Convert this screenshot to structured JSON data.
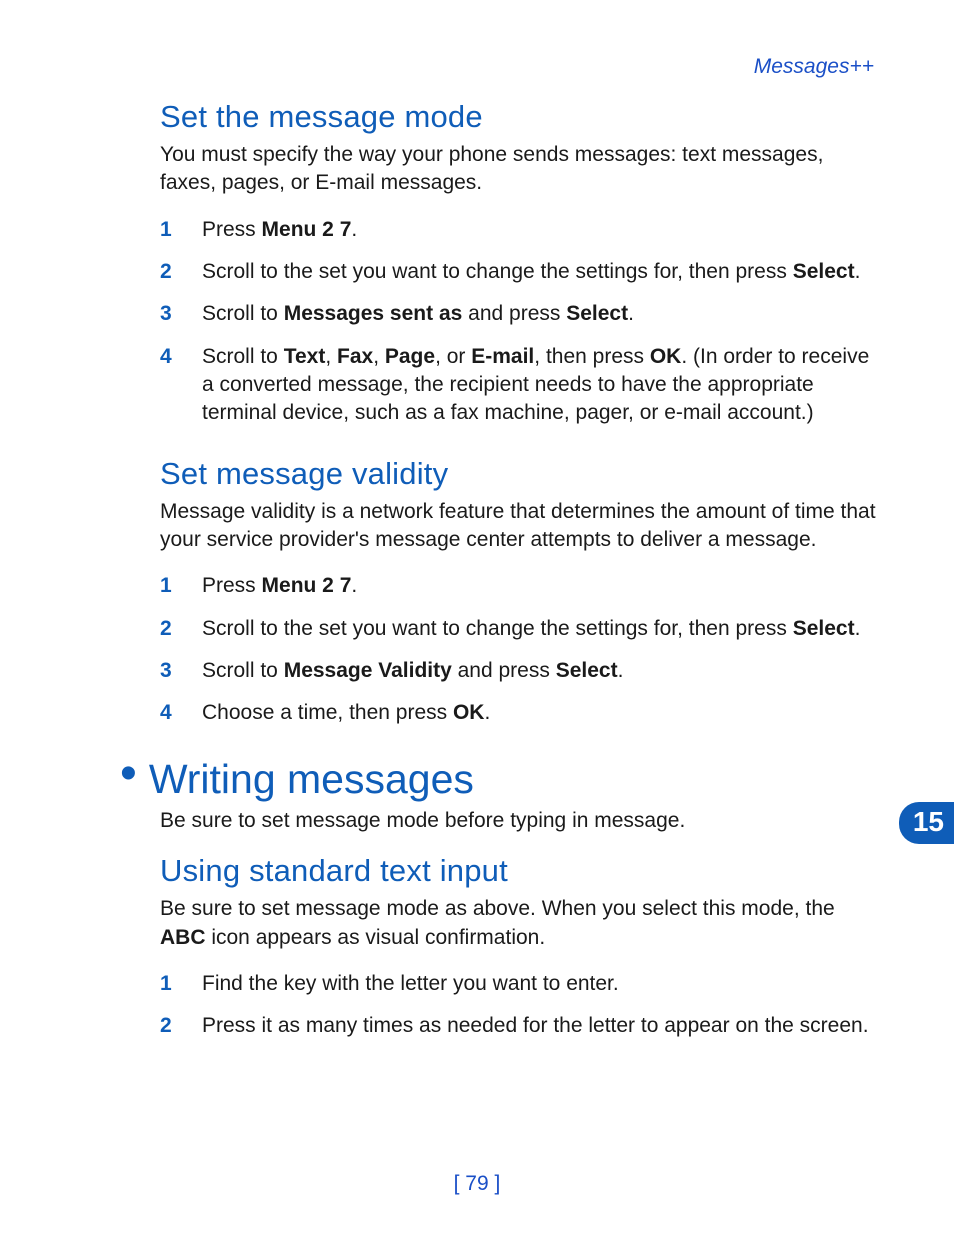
{
  "header": {
    "running": "Messages++"
  },
  "sections": {
    "mode": {
      "title": "Set the message mode",
      "intro": "You must specify the way your phone sends messages: text messages, faxes, pages, or E-mail messages.",
      "steps": [
        {
          "n": "1",
          "pre": "Press ",
          "b1": "Menu 2 7",
          "post": "."
        },
        {
          "n": "2",
          "pre": "Scroll to the set you want to change the settings for, then press ",
          "b1": "Select",
          "post": "."
        },
        {
          "n": "3",
          "pre": "Scroll to ",
          "b1": "Messages sent as",
          "mid": " and press ",
          "b2": "Select",
          "post": "."
        },
        {
          "n": "4",
          "pre": "Scroll to ",
          "b1": "Text",
          "c1": ", ",
          "b2": "Fax",
          "c2": ", ",
          "b3": "Page",
          "c3": ", or ",
          "b4": "E-mail",
          "mid": ", then press ",
          "b5": "OK",
          "post": ". (In order to receive a converted message, the recipient needs to have the appropriate terminal device, such as a fax machine, pager, or e-mail account.)"
        }
      ]
    },
    "validity": {
      "title": "Set message validity",
      "intro": "Message validity is a network feature that determines the amount of time that your service provider's message center attempts to deliver a message.",
      "steps": [
        {
          "n": "1",
          "pre": "Press ",
          "b1": "Menu 2 7",
          "post": "."
        },
        {
          "n": "2",
          "pre": "Scroll to the set you want to change the settings for, then press ",
          "b1": "Select",
          "post": "."
        },
        {
          "n": "3",
          "pre": "Scroll to ",
          "b1": "Message Validity",
          "mid": " and press ",
          "b2": "Select",
          "post": "."
        },
        {
          "n": "4",
          "pre": "Choose a time, then press ",
          "b1": "OK",
          "post": "."
        }
      ]
    },
    "writing": {
      "title": "Writing messages",
      "intro": "Be sure to set message mode before typing in message."
    },
    "standard": {
      "title": "Using standard text input",
      "intro_pre": "Be sure to set message mode as above. When you select this mode, the ",
      "intro_b": "ABC",
      "intro_post": " icon appears as visual confirmation.",
      "steps": [
        {
          "n": "1",
          "pre": "Find the key with the letter you want to enter."
        },
        {
          "n": "2",
          "pre": "Press it as many times as needed for the letter to appear on the screen."
        }
      ]
    }
  },
  "tab": "15",
  "footer": "[ 79 ]"
}
